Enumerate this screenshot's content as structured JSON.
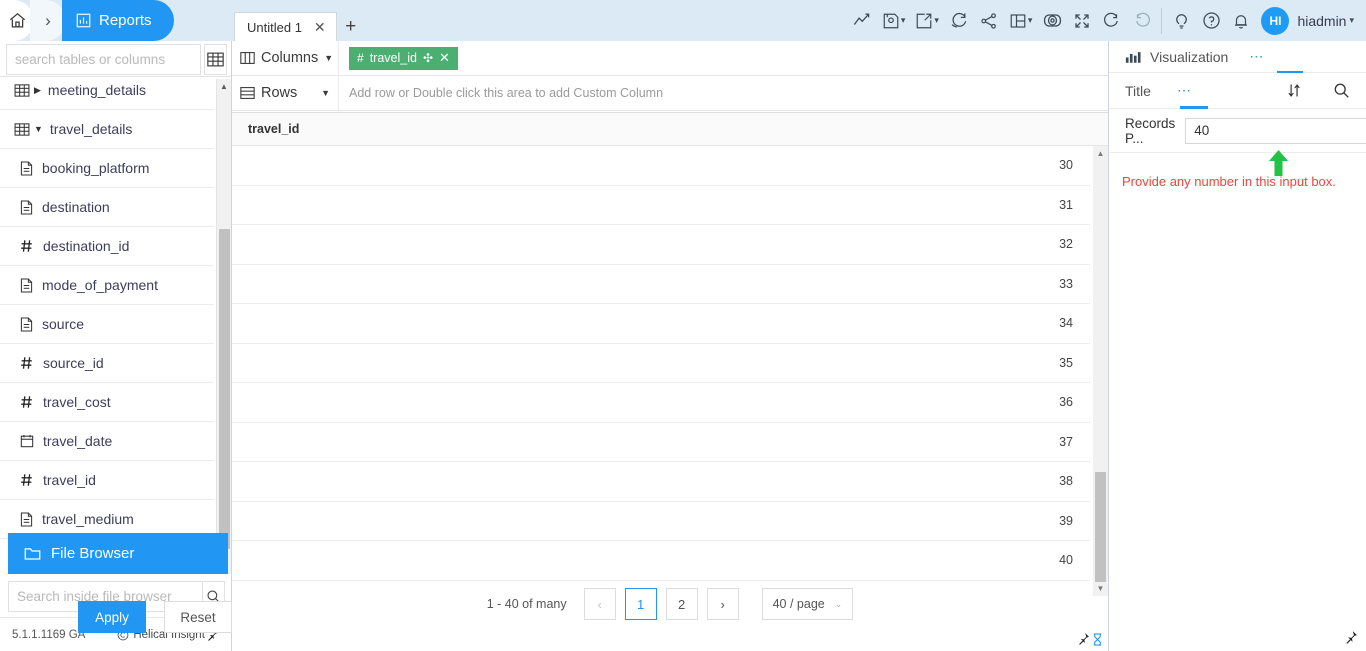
{
  "topbar": {
    "home_icon": "home-icon",
    "breadcrumb_sep": "›",
    "module_label": "Reports",
    "module_icon": "bar-chart-icon",
    "tabs": [
      {
        "label": "Untitled 1",
        "close": "✕"
      }
    ],
    "add_tab": "+",
    "tools": [
      {
        "name": "chart-line-icon",
        "caret": false
      },
      {
        "name": "save-icon",
        "caret": true
      },
      {
        "name": "export-icon",
        "caret": true
      },
      {
        "name": "refresh-icon",
        "caret": false
      },
      {
        "name": "share-icon",
        "caret": false
      },
      {
        "name": "layout-icon",
        "caret": true
      },
      {
        "name": "preview-icon",
        "caret": false
      },
      {
        "name": "fullscreen-icon",
        "caret": false
      },
      {
        "name": "undo-icon",
        "caret": false
      },
      {
        "name": "redo-icon",
        "caret": false
      }
    ],
    "right_icons": [
      {
        "name": "idea-bulb-icon"
      },
      {
        "name": "help-circle-icon"
      },
      {
        "name": "notification-bell-icon"
      }
    ],
    "user": {
      "initials": "HI",
      "name": "hiadmin",
      "caret": "⌄"
    }
  },
  "sidebar": {
    "search_placeholder": "search tables or columns",
    "search_value": "",
    "grid_icon": "table-grid-icon",
    "tree": [
      {
        "label": "meeting_details",
        "icon": "table-icon",
        "arrow": "▶",
        "type": "table"
      },
      {
        "label": "travel_details",
        "icon": "table-icon",
        "arrow": "▼",
        "type": "table"
      },
      {
        "label": "booking_platform",
        "icon": "text-field-icon",
        "type": "column"
      },
      {
        "label": "destination",
        "icon": "text-field-icon",
        "type": "column"
      },
      {
        "label": "destination_id",
        "icon": "number-field-icon",
        "type": "column"
      },
      {
        "label": "mode_of_payment",
        "icon": "text-field-icon",
        "type": "column"
      },
      {
        "label": "source",
        "icon": "text-field-icon",
        "type": "column"
      },
      {
        "label": "source_id",
        "icon": "number-field-icon",
        "type": "column"
      },
      {
        "label": "travel_cost",
        "icon": "number-field-icon",
        "type": "column"
      },
      {
        "label": "travel_date",
        "icon": "date-field-icon",
        "type": "column"
      },
      {
        "label": "travel_id",
        "icon": "number-field-icon",
        "type": "column"
      },
      {
        "label": "travel_medium",
        "icon": "text-field-icon",
        "type": "column"
      }
    ],
    "file_browser": {
      "label": "File Browser",
      "icon": "folder-icon"
    },
    "fb_search_placeholder": "Search inside file browser",
    "fb_search_value": "",
    "fb_search_icon": "search-icon",
    "footer": {
      "version": "5.1.1.1169 GA",
      "copyright": "©",
      "brand": "Helical Insight",
      "pin_icon": "pin-icon"
    }
  },
  "shelves": {
    "columns": {
      "label": "Columns",
      "icon": "columns-icon",
      "caret": "▼",
      "chips": [
        {
          "label": "travel_id",
          "hash": "#",
          "move": "✣",
          "close": "✕",
          "color": "#4caf72"
        }
      ]
    },
    "rows": {
      "label": "Rows",
      "icon": "rows-icon",
      "caret": "▼",
      "placeholder": "Add row or Double click this area to add Custom Column"
    }
  },
  "table": {
    "headers": [
      "travel_id"
    ],
    "rows": [
      [
        "30"
      ],
      [
        "31"
      ],
      [
        "32"
      ],
      [
        "33"
      ],
      [
        "34"
      ],
      [
        "35"
      ],
      [
        "36"
      ],
      [
        "37"
      ],
      [
        "38"
      ],
      [
        "39"
      ],
      [
        "40"
      ]
    ]
  },
  "pager": {
    "count_text": "1 - 40 of many",
    "prev": "‹",
    "next": "›",
    "pages": [
      {
        "label": "1",
        "active": true
      },
      {
        "label": "2",
        "active": false
      }
    ],
    "page_size": "40 / page",
    "page_size_caret": "⌄",
    "pin_icon": "pin-icon",
    "hourglass_icon": "hourglass-icon"
  },
  "rightpanel": {
    "header": {
      "title": "Visualization",
      "icon": "chart-icon",
      "dots": "⋯"
    },
    "sub": {
      "title": "Title",
      "dots": "⋯",
      "sort_icon": "sort-icon",
      "search_icon": "search-icon"
    },
    "field": {
      "label": "Records P...",
      "value": "40"
    },
    "annotation": {
      "arrow_icon": "up-arrow-annotation",
      "arrow_color": "#22c246",
      "text": "Provide any number in this input box.",
      "text_color": "#f4433a"
    },
    "apply_label": "Apply",
    "reset_label": "Reset",
    "pin_icon": "pin-icon"
  },
  "colors": {
    "accent": "#2196f3",
    "topbar_bg": "#dbeaf4",
    "chip_green": "#4caf72",
    "annotation_red": "#f4433a",
    "annotation_green": "#22c246"
  }
}
